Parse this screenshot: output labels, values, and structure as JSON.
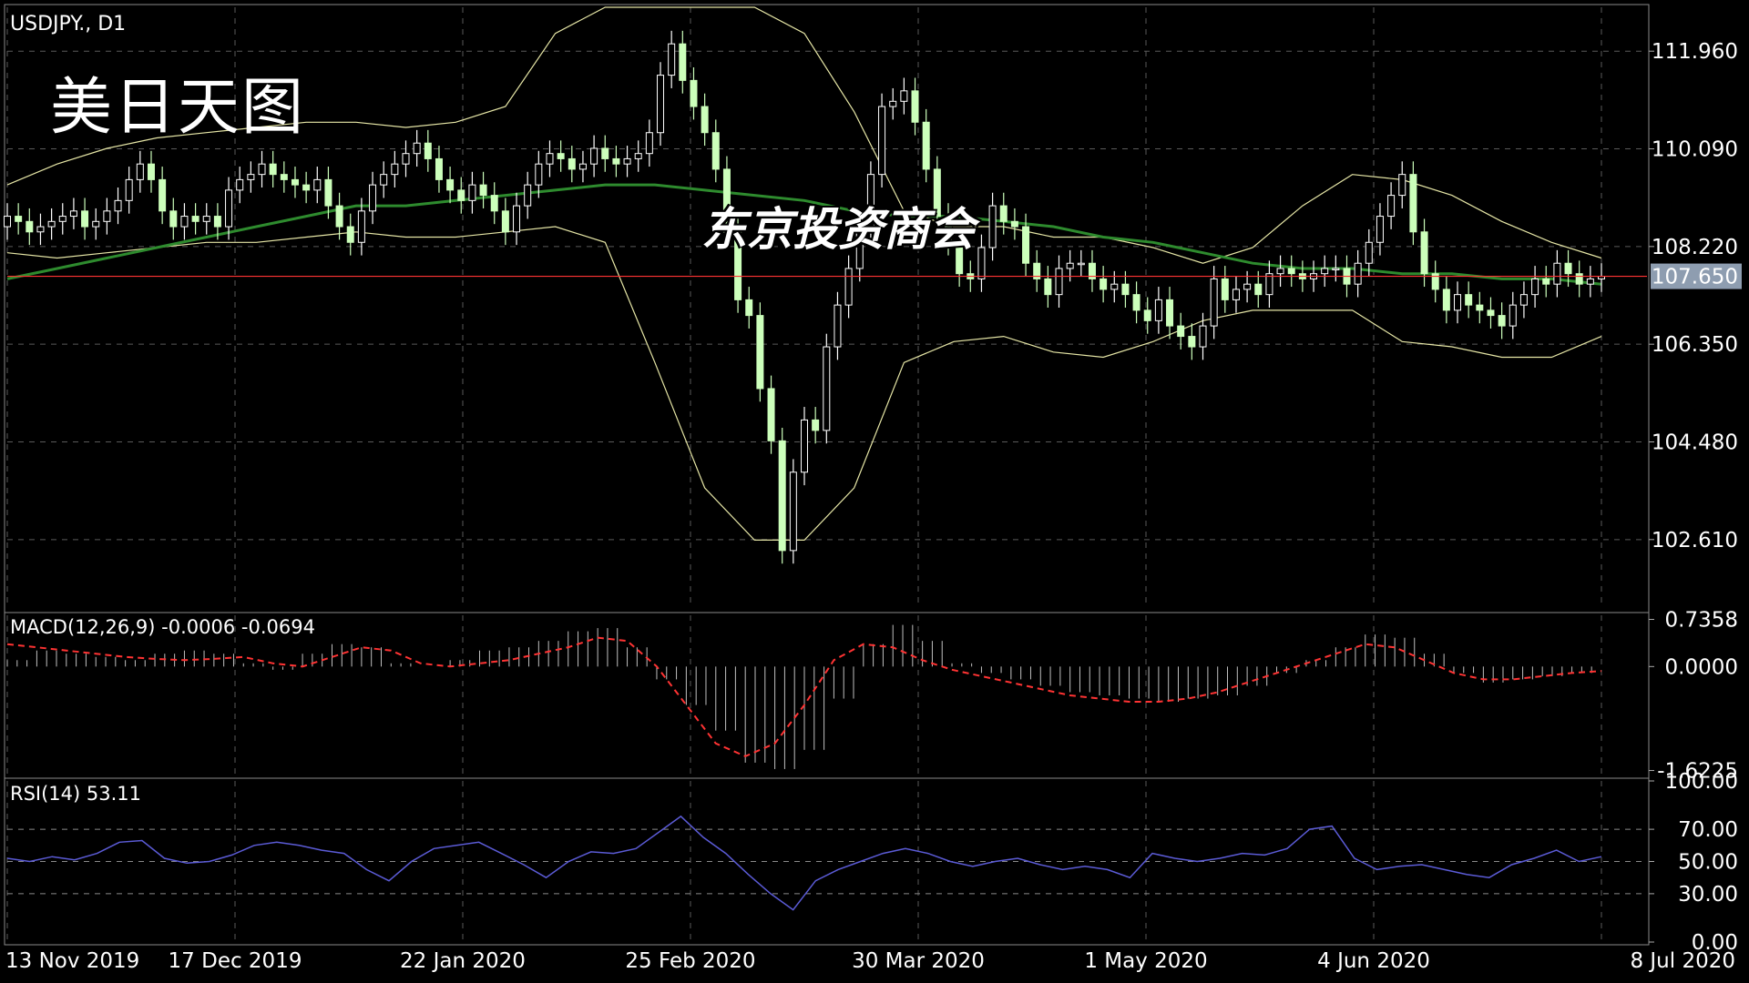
{
  "header": {
    "symbol_label": "USDJPY., D1"
  },
  "overlay_title": "美日天图",
  "watermark": "东京投资商会",
  "colors": {
    "background": "#000000",
    "grid": "#5a5a5a",
    "candle_up": "#ffffff",
    "candle_down": "#ccffbb",
    "bollinger": "#e6e6a6",
    "moving_average": "#2e8b2e",
    "price_line": "#ff3333",
    "macd_histogram": "#c0c0c0",
    "macd_signal": "#ff3333",
    "rsi_line": "#5b5bd6",
    "current_price_badge": "#8e9db0"
  },
  "chart_data": [
    {
      "type": "candlestick",
      "panel": "price",
      "title": "USDJPY., D1",
      "x_tick_labels": [
        "13 Nov 2019",
        "17 Dec 2019",
        "22 Jan 2020",
        "25 Feb 2020",
        "30 Mar 2020",
        "1 May 2020",
        "4 Jun 2020",
        "8 Jul 2020"
      ],
      "y_tick_labels": [
        "111.960",
        "110.090",
        "108.220",
        "106.350",
        "104.480",
        "102.610"
      ],
      "ylim": [
        101.3,
        112.8
      ],
      "current_price": "107.650",
      "grid": true,
      "series": [
        {
          "name": "close",
          "values": [
            108.8,
            108.7,
            108.5,
            108.6,
            108.7,
            108.8,
            108.9,
            108.6,
            108.7,
            108.9,
            109.1,
            109.5,
            109.8,
            109.5,
            108.9,
            108.6,
            108.8,
            108.7,
            108.8,
            108.6,
            109.3,
            109.5,
            109.6,
            109.8,
            109.6,
            109.5,
            109.4,
            109.3,
            109.5,
            109.0,
            108.6,
            108.3,
            108.9,
            109.4,
            109.6,
            109.8,
            110.0,
            110.2,
            109.9,
            109.5,
            109.3,
            109.1,
            109.4,
            109.2,
            108.9,
            108.5,
            109.0,
            109.4,
            109.8,
            110.0,
            109.9,
            109.7,
            109.8,
            110.1,
            109.9,
            109.8,
            109.9,
            110.0,
            110.4,
            111.5,
            112.1,
            111.4,
            110.9,
            110.4,
            109.7,
            108.5,
            107.2,
            106.9,
            105.5,
            104.5,
            102.4,
            103.9,
            104.9,
            104.7,
            106.3,
            107.1,
            107.8,
            108.5,
            109.6,
            110.9,
            111.0,
            111.2,
            110.6,
            109.7,
            108.8,
            108.3,
            107.7,
            107.6,
            108.2,
            109.0,
            108.7,
            108.6,
            107.9,
            107.6,
            107.3,
            107.8,
            107.9,
            107.9,
            107.6,
            107.4,
            107.5,
            107.3,
            107.0,
            106.8,
            107.2,
            106.7,
            106.5,
            106.3,
            106.7,
            107.6,
            107.2,
            107.4,
            107.5,
            107.3,
            107.7,
            107.8,
            107.7,
            107.6,
            107.7,
            107.8,
            107.8,
            107.5,
            107.9,
            108.3,
            108.8,
            109.2,
            109.6,
            108.5,
            107.7,
            107.4,
            107.0,
            107.3,
            107.1,
            107.0,
            106.9,
            106.7,
            107.1,
            107.3,
            107.6,
            107.5,
            107.9,
            107.7,
            107.5,
            107.6,
            107.65
          ]
        },
        {
          "name": "bollinger_upper",
          "values": [
            109.4,
            109.8,
            110.1,
            110.3,
            110.4,
            110.5,
            110.6,
            110.6,
            110.5,
            110.6,
            110.9,
            112.3,
            112.8,
            112.8,
            112.8,
            112.8,
            112.3,
            110.8,
            108.9,
            108.6,
            108.6,
            108.4,
            108.4,
            108.2,
            107.9,
            108.2,
            109.0,
            109.6,
            109.5,
            109.2,
            108.7,
            108.3,
            108.0
          ]
        },
        {
          "name": "bollinger_lower",
          "values": [
            108.1,
            108.0,
            108.1,
            108.2,
            108.3,
            108.3,
            108.4,
            108.5,
            108.4,
            108.4,
            108.5,
            108.6,
            108.3,
            106.0,
            103.6,
            102.6,
            102.6,
            103.6,
            106.0,
            106.4,
            106.5,
            106.2,
            106.1,
            106.4,
            106.8,
            107.0,
            107.0,
            107.0,
            106.4,
            106.3,
            106.1,
            106.1,
            106.5
          ]
        },
        {
          "name": "moving_average",
          "values": [
            107.6,
            107.8,
            108.0,
            108.2,
            108.4,
            108.6,
            108.8,
            109.0,
            109.0,
            109.1,
            109.2,
            109.3,
            109.4,
            109.4,
            109.3,
            109.2,
            109.1,
            108.9,
            108.8,
            108.8,
            108.7,
            108.6,
            108.4,
            108.3,
            108.1,
            107.9,
            107.8,
            107.8,
            107.7,
            107.7,
            107.6,
            107.6,
            107.5
          ]
        }
      ]
    },
    {
      "type": "bar",
      "panel": "macd",
      "label": "MACD(12,26,9) -0.0006 -0.0694",
      "y_tick_labels": [
        "0.7358",
        "0.0000",
        "-1.6225"
      ],
      "ylim": [
        -1.7,
        0.8
      ],
      "series": [
        {
          "name": "histogram",
          "values": [
            0.1,
            0.25,
            0.2,
            0.15,
            0.1,
            0.2,
            0.25,
            0.2,
            0.05,
            -0.05,
            0.2,
            0.35,
            0.3,
            0.05,
            0.0,
            0.1,
            0.25,
            0.3,
            0.4,
            0.55,
            0.6,
            0.3,
            -0.2,
            -0.6,
            -1.0,
            -1.5,
            -1.6,
            -1.3,
            -0.5,
            0.35,
            0.65,
            0.4,
            0.05,
            -0.1,
            -0.2,
            -0.3,
            -0.4,
            -0.45,
            -0.5,
            -0.55,
            -0.5,
            -0.45,
            -0.3,
            -0.1,
            0.1,
            0.3,
            0.5,
            0.45,
            0.2,
            -0.1,
            -0.25,
            -0.2,
            -0.15,
            -0.1,
            0.0
          ]
        },
        {
          "name": "signal",
          "values": [
            0.35,
            0.3,
            0.25,
            0.2,
            0.15,
            0.12,
            0.1,
            0.12,
            0.15,
            0.05,
            0.0,
            0.15,
            0.3,
            0.25,
            0.05,
            0.0,
            0.05,
            0.1,
            0.2,
            0.3,
            0.45,
            0.4,
            0.0,
            -0.6,
            -1.2,
            -1.4,
            -1.2,
            -0.6,
            0.1,
            0.35,
            0.3,
            0.1,
            -0.05,
            -0.15,
            -0.25,
            -0.35,
            -0.45,
            -0.5,
            -0.55,
            -0.55,
            -0.5,
            -0.4,
            -0.25,
            -0.1,
            0.05,
            0.2,
            0.35,
            0.3,
            0.1,
            -0.1,
            -0.2,
            -0.2,
            -0.15,
            -0.1,
            -0.07
          ]
        }
      ]
    },
    {
      "type": "line",
      "panel": "rsi",
      "label": "RSI(14) 53.11",
      "y_tick_labels": [
        "100.00",
        "70.00",
        "50.00",
        "30.00",
        "0.00"
      ],
      "ylim": [
        0,
        100
      ],
      "reference_levels": [
        70,
        50,
        30
      ],
      "series": [
        {
          "name": "RSI",
          "values": [
            52,
            50,
            53,
            51,
            55,
            62,
            63,
            52,
            49,
            50,
            54,
            60,
            62,
            60,
            57,
            55,
            45,
            38,
            50,
            58,
            60,
            62,
            55,
            48,
            40,
            50,
            56,
            55,
            58,
            68,
            78,
            65,
            55,
            42,
            30,
            20,
            38,
            45,
            50,
            55,
            58,
            55,
            50,
            47,
            50,
            52,
            48,
            45,
            47,
            45,
            40,
            55,
            52,
            50,
            52,
            55,
            54,
            58,
            70,
            72,
            52,
            45,
            47,
            48,
            45,
            42,
            40,
            48,
            52,
            57,
            50,
            53
          ]
        }
      ]
    }
  ]
}
